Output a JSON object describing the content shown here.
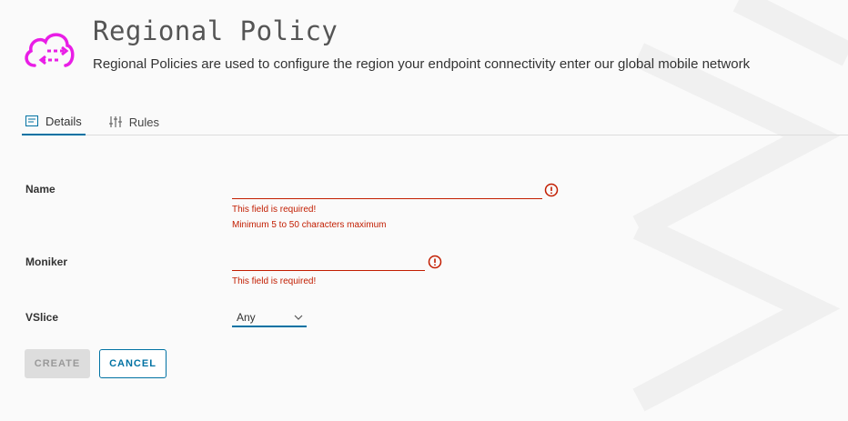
{
  "header": {
    "title": "Regional Policy",
    "description": "Regional Policies are used to configure the region your endpoint connectivity enter our global mobile network",
    "logo_icon": "cloud-transfer-icon",
    "accent_color": "#e91ee6"
  },
  "tabs": [
    {
      "label": "Details",
      "icon": "form-icon",
      "active": true
    },
    {
      "label": "Rules",
      "icon": "sliders-icon",
      "active": false
    }
  ],
  "form": {
    "name": {
      "label": "Name",
      "value": "",
      "errors": [
        "This field is required!",
        "Minimum 5 to 50 characters maximum"
      ]
    },
    "moniker": {
      "label": "Moniker",
      "value": "",
      "errors": [
        "This field is required!"
      ]
    },
    "vslice": {
      "label": "VSlice",
      "selected": "Any"
    }
  },
  "buttons": {
    "create": "CREATE",
    "cancel": "CANCEL"
  },
  "colors": {
    "primary": "#0072a3",
    "error": "#c21d00",
    "disabled_bg": "#dddddd"
  }
}
